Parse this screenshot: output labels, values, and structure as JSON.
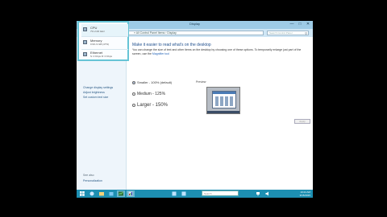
{
  "window": {
    "title": "Display",
    "minimize": "—",
    "maximize": "□",
    "close": "✕"
  },
  "address_bar": {
    "path": "« All Control Panel Items › Display",
    "search_placeholder": "Search Control Panel"
  },
  "left_pane": {
    "links": [
      "Change display settings",
      "Adjust brightness",
      "Set custom text size"
    ],
    "see_also_header": "See also",
    "see_also_items": [
      "Personalization"
    ]
  },
  "content": {
    "heading": "Make it easier to read what's on the desktop",
    "description": "You can change the size of text and other items on the desktop by choosing one of these options. To temporarily enlarge just part of the screen, use the",
    "description_link": "Magnifier tool",
    "options": [
      {
        "label": "Smaller - 100% (default)",
        "selected": true
      },
      {
        "label": "Medium - 125%",
        "selected": false
      },
      {
        "label": "Larger - 150%",
        "selected": false
      }
    ],
    "preview_label": "Preview",
    "apply_label": "Apply"
  },
  "jump_list": {
    "items": [
      {
        "title": "CPU",
        "subtitle": "7% 2.06 GHz",
        "selected": true
      },
      {
        "title": "Memory",
        "subtitle": "0.9/1.9 GB (47%)",
        "selected": false
      },
      {
        "title": "Ethernet",
        "subtitle": "S: 0 Kbps R: 0 Kbps",
        "selected": false
      }
    ]
  },
  "taskbar": {
    "search_placeholder": "Search",
    "time": "10:24 AM",
    "date": "3/15/2015"
  },
  "colors": {
    "accent": "#1d8fb2",
    "titlebar": "#9ecbe6",
    "highlight_border": "#66c4d6"
  }
}
